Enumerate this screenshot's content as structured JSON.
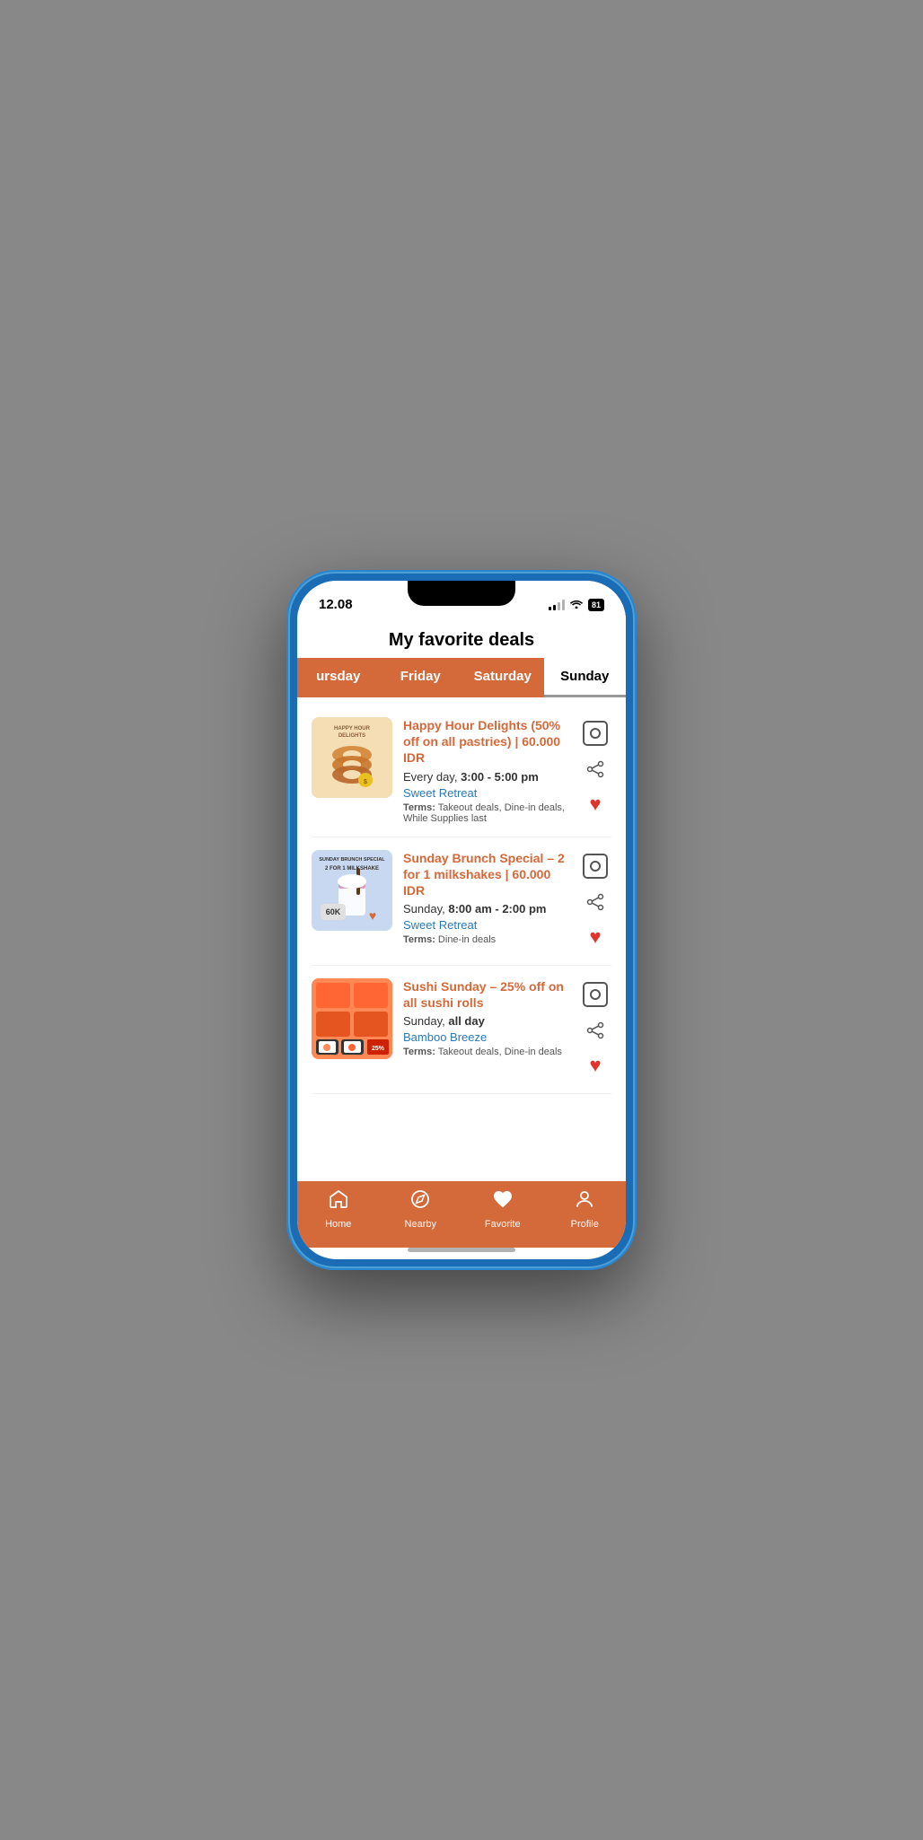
{
  "statusBar": {
    "time": "12.08",
    "battery": "81"
  },
  "header": {
    "title": "My favorite deals"
  },
  "tabs": [
    {
      "id": "thursday",
      "label": "ursday",
      "active": true
    },
    {
      "id": "friday",
      "label": "Friday",
      "active": true
    },
    {
      "id": "saturday",
      "label": "Saturday",
      "active": true
    },
    {
      "id": "sunday",
      "label": "Sunday",
      "active": false
    }
  ],
  "deals": [
    {
      "id": "happy-hour",
      "title": "Happy Hour Delights (50% off on all pastries) | 60.000 IDR",
      "time": "Every day, ",
      "timeHighlight": "3:00 - 5:00 pm",
      "venue": "Sweet Retreat",
      "termsLabel": "Terms:",
      "terms": " Takeout deals, Dine-in deals, While Supplies last",
      "imageType": "happy-hour",
      "imageLabel": "HAPPY HOUR DELIGHTS",
      "favorited": true
    },
    {
      "id": "sunday-brunch",
      "title": "Sunday Brunch Special – 2 for 1 milkshakes | 60.000 IDR",
      "time": "Sunday, ",
      "timeHighlight": "8:00 am - 2:00 pm",
      "venue": "Sweet Retreat",
      "termsLabel": "Terms:",
      "terms": " Dine-in deals",
      "imageType": "brunch",
      "imageLabel": "SUNDAY BRUNCH SPECIAL 2 FOR 1 MILKSHAKE 60K",
      "favorited": true
    },
    {
      "id": "sushi-sunday",
      "title": "Sushi Sunday – 25% off on all sushi rolls",
      "time": "Sunday, ",
      "timeHighlight": "all day",
      "venue": "Bamboo Breeze",
      "termsLabel": "Terms:",
      "terms": " Takeout deals, Dine-in deals",
      "imageType": "sushi",
      "imageLabel": "Delicious Sushi Rolls",
      "favorited": true
    }
  ],
  "bottomNav": [
    {
      "id": "home",
      "label": "Home",
      "icon": "home",
      "active": false
    },
    {
      "id": "nearby",
      "label": "Nearby",
      "icon": "compass",
      "active": false
    },
    {
      "id": "favorite",
      "label": "Favorite",
      "icon": "heart",
      "active": true
    },
    {
      "id": "profile",
      "label": "Profile",
      "icon": "person",
      "active": false
    }
  ],
  "colors": {
    "primary": "#d4693a",
    "blue": "#2979b8",
    "heartRed": "#e0332e",
    "tabActiveBg": "#d4693a",
    "tabActiveText": "#ffffff"
  }
}
